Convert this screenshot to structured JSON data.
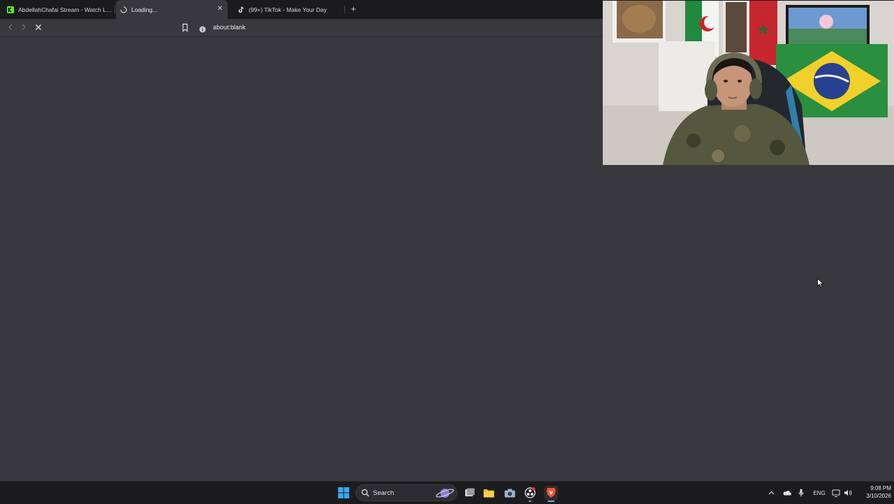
{
  "browser": {
    "tabs": [
      {
        "title": "AbdellahChafai Stream - Watch Live o",
        "favicon": "kick-icon",
        "active": false
      },
      {
        "title": "Loading...",
        "favicon": "loading-spinner-icon",
        "active": true
      },
      {
        "title": "(99+) TikTok - Make Your Day",
        "favicon": "tiktok-icon",
        "active": false
      }
    ],
    "address": {
      "url": "about:blank"
    }
  },
  "taskbar": {
    "search_label": "Search",
    "tray": {
      "language": "ENG"
    },
    "clock": {
      "time": "9:08 PM",
      "date": "3/10/2026"
    }
  },
  "colors": {
    "page_bg": "#38383d",
    "tabstrip_bg": "#1b1b1e",
    "kick_green": "#53fc18",
    "brave_orange": "#fb542b"
  }
}
